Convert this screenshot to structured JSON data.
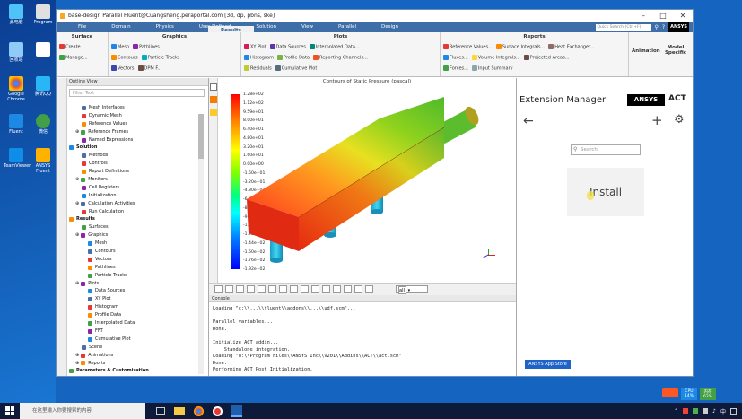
{
  "window": {
    "title": "base-design Parallel Fluent@Cuangsheng.peraportal.com [3d, dp, pbns, ske]"
  },
  "ribbon_tabs": [
    "File",
    "Domain",
    "Physics",
    "User-Defined",
    "Solution",
    "Results",
    "View",
    "Parallel",
    "Design"
  ],
  "ribbon_active": "Results",
  "ribbon_search": "Quick Search (Ctrl+F)",
  "ribbon_groups": {
    "surface": {
      "title": "Surface",
      "items": [
        "Create",
        "Manage..."
      ]
    },
    "graphics": {
      "title": "Graphics",
      "items": [
        "Mesh",
        "Contours",
        "Vectors",
        "Pathlines",
        "Particle Tracks",
        "DPM F..."
      ]
    },
    "plots": {
      "title": "Plots",
      "items": [
        "XY Plot",
        "Histogram",
        "Residuals",
        "Data Sources",
        "Profile Data",
        "Interpolated Data...",
        "Reporting Channels...",
        "Cumulative Plot"
      ]
    },
    "reports": {
      "title": "Reports",
      "items": [
        "Reference Values...",
        "Fluxes...",
        "Forces...",
        "Surface Integrals...",
        "Volume Integrals...",
        "Heat Exchanger...",
        "Input Summary",
        "Projected Areas..."
      ]
    },
    "animation": {
      "title": "Animation"
    },
    "model": {
      "title": "Model Specific"
    }
  },
  "outline": {
    "header": "Outline View",
    "filter_placeholder": "Filter Text",
    "items": [
      {
        "label": "Mesh Interfaces",
        "level": 2,
        "bold": false
      },
      {
        "label": "Dynamic Mesh",
        "level": 2,
        "bold": false
      },
      {
        "label": "Reference Values",
        "level": 2,
        "bold": false
      },
      {
        "label": "Reference Frames",
        "level": 1,
        "bold": false
      },
      {
        "label": "Named Expressions",
        "level": 2,
        "bold": false
      },
      {
        "label": "Solution",
        "level": 0,
        "bold": true
      },
      {
        "label": "Methods",
        "level": 2,
        "bold": false
      },
      {
        "label": "Controls",
        "level": 2,
        "bold": false
      },
      {
        "label": "Report Definitions",
        "level": 2,
        "bold": false
      },
      {
        "label": "Monitors",
        "level": 1,
        "bold": false
      },
      {
        "label": "Cell Registers",
        "level": 2,
        "bold": false
      },
      {
        "label": "Initialization",
        "level": 2,
        "bold": false
      },
      {
        "label": "Calculation Activities",
        "level": 1,
        "bold": false
      },
      {
        "label": "Run Calculation",
        "level": 2,
        "bold": false
      },
      {
        "label": "Results",
        "level": 0,
        "bold": true
      },
      {
        "label": "Surfaces",
        "level": 2,
        "bold": false
      },
      {
        "label": "Graphics",
        "level": 1,
        "bold": false
      },
      {
        "label": "Mesh",
        "level": 3,
        "bold": false
      },
      {
        "label": "Contours",
        "level": 3,
        "bold": false
      },
      {
        "label": "Vectors",
        "level": 3,
        "bold": false
      },
      {
        "label": "Pathlines",
        "level": 3,
        "bold": false
      },
      {
        "label": "Particle Tracks",
        "level": 3,
        "bold": false
      },
      {
        "label": "Plots",
        "level": 1,
        "bold": false
      },
      {
        "label": "Data Sources",
        "level": 3,
        "bold": false
      },
      {
        "label": "XY Plot",
        "level": 3,
        "bold": false
      },
      {
        "label": "Histogram",
        "level": 3,
        "bold": false
      },
      {
        "label": "Profile Data",
        "level": 3,
        "bold": false
      },
      {
        "label": "Interpolated Data",
        "level": 3,
        "bold": false
      },
      {
        "label": "FFT",
        "level": 3,
        "bold": false
      },
      {
        "label": "Cumulative Plot",
        "level": 3,
        "bold": false
      },
      {
        "label": "Scene",
        "level": 2,
        "bold": false
      },
      {
        "label": "Animations",
        "level": 1,
        "bold": false
      },
      {
        "label": "Reports",
        "level": 1,
        "bold": false
      },
      {
        "label": "Parameters & Customization",
        "level": 0,
        "bold": true
      }
    ]
  },
  "graphics": {
    "title": "Contours of Static Pressure (pascal)",
    "legend": [
      "1.28e+02",
      "1.12e+02",
      "9.59e+01",
      "8.00e+01",
      "6.40e+01",
      "4.80e+01",
      "3.20e+01",
      "1.60e+01",
      "0.00e+00",
      "-1.60e+01",
      "-3.20e+01",
      "-4.80e+01",
      "-6.40e+01",
      "-8.00e+01",
      "-9.59e+01",
      "-1.12e+02",
      "-1.28e+02",
      "-1.44e+02",
      "-1.60e+02",
      "-1.76e+02",
      "-1.92e+02"
    ],
    "view_select": "all"
  },
  "console": {
    "header": "Console",
    "lines": [
      "Loading \"c:\\\\...\\\\fluent\\\\addons\\\\...\\\\udf.scm\"...",
      "",
      "Parallel variables...",
      "Done.",
      "",
      "Initialize ACT addin...",
      "    Standalone integration.",
      "Loading \"d:\\\\Program Files\\\\ANSYS Inc\\\\v201\\\\Addins\\\\ACT\\\\act.scm\"",
      "Done.",
      "Performing ACT Post Initialization."
    ]
  },
  "extension_manager": {
    "title": "Extension Manager",
    "brand": "ANSYS",
    "product": "ACT",
    "search_placeholder": "Search",
    "install_label": "Install",
    "appstore_label": "ANSYS App Store"
  },
  "desktop_icons": [
    "此电脑",
    "Program",
    "回收站",
    "",
    "Google Chrome",
    "腾讯QQ",
    "Fluent",
    "微信",
    "TeamViewer",
    "ANSYS Fluent"
  ],
  "taskbar": {
    "search_placeholder": "在这里输入你要搜索的内容",
    "tray_badges": [
      "CPU 14%",
      "内存 62%"
    ]
  }
}
